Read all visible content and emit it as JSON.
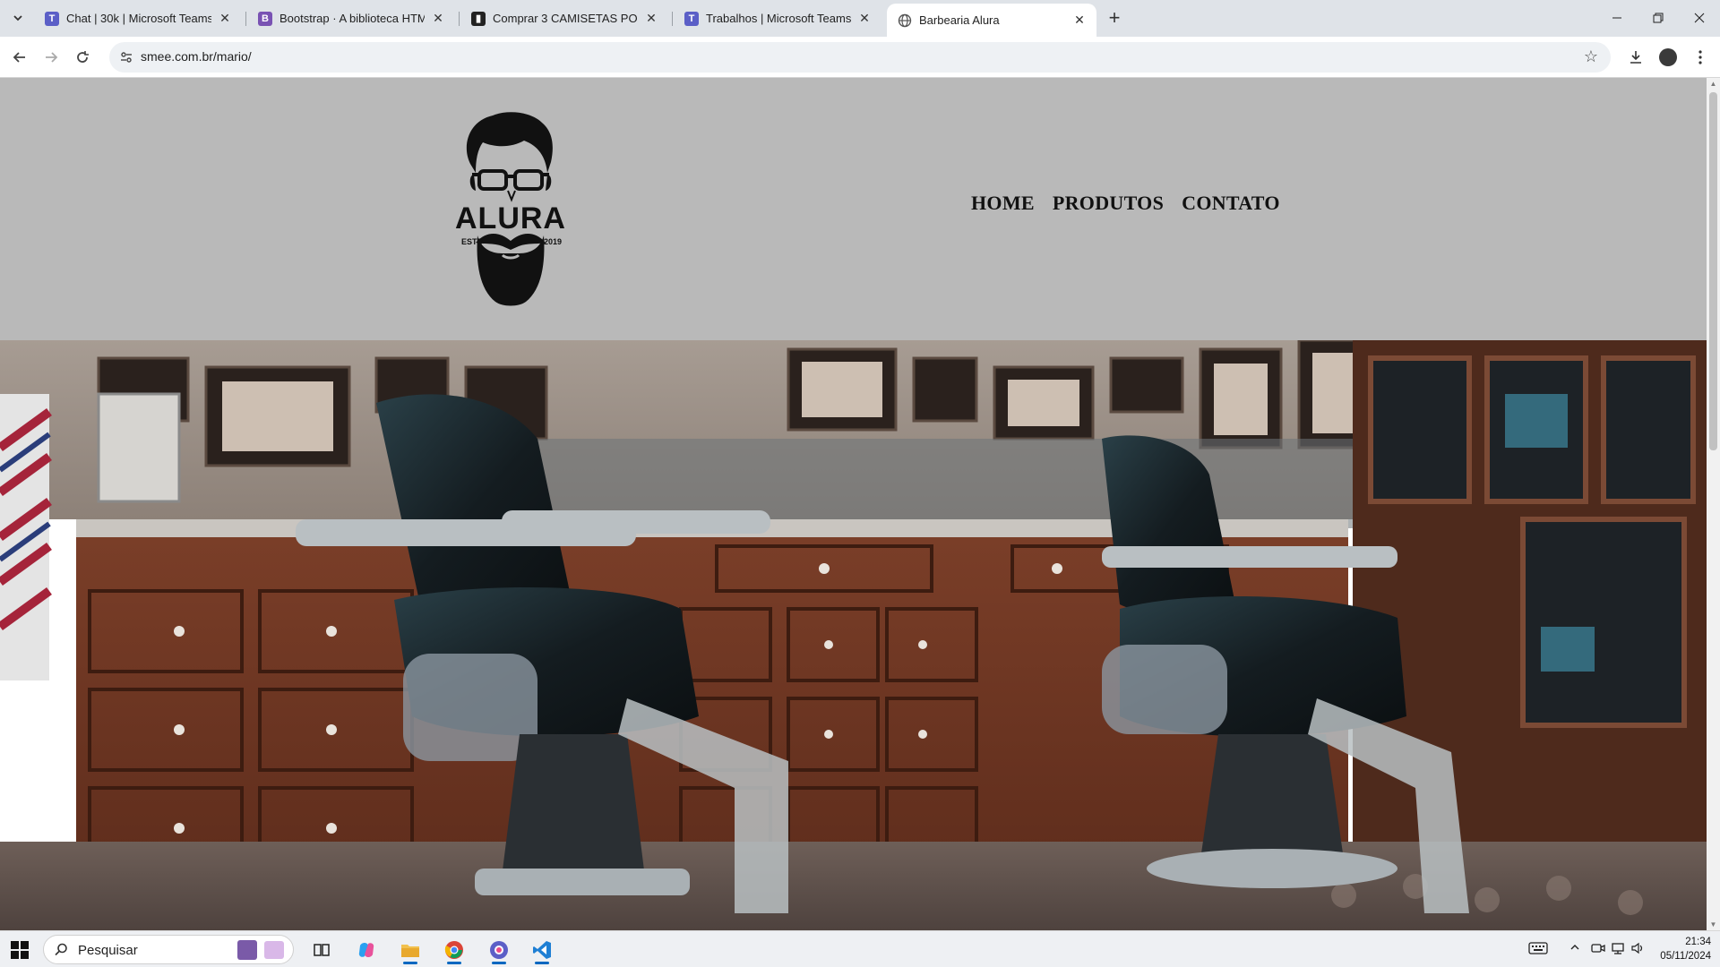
{
  "browser": {
    "tabs": [
      {
        "title": "Chat | 30k | Microsoft Teams",
        "favicon": "teams-icon",
        "color": "#5b5fc7"
      },
      {
        "title": "Bootstrap · A biblioteca HTML,",
        "favicon": "bootstrap-icon",
        "color": "#7952b3"
      },
      {
        "title": "Comprar 3 CAMISETAS POR R$",
        "favicon": "store-icon",
        "color": "#222222"
      },
      {
        "title": "Trabalhos | Microsoft Teams",
        "favicon": "teams-icon",
        "color": "#5b5fc7"
      },
      {
        "title": "Barbearia Alura",
        "favicon": "globe-icon",
        "color": "#555555"
      }
    ],
    "active_tab_index": 4,
    "url": "smee.com.br/mario/"
  },
  "page": {
    "logo": {
      "wordmark": "ALURA",
      "estd_label": "ESTD",
      "year": "2019"
    },
    "nav": [
      "HOME",
      "PRODUTOS",
      "CONTATO"
    ],
    "header_bg": "#b9b9b9"
  },
  "taskbar": {
    "search_placeholder": "Pesquisar",
    "time": "21:34",
    "date": "05/11/2024"
  }
}
